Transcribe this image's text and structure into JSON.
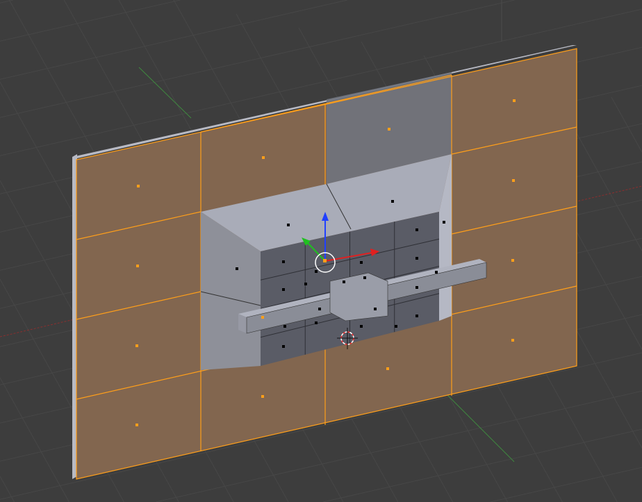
{
  "viewport": {
    "background_color": "#3d3d3d",
    "grid_color": "#474747",
    "x_axis_color": "#8a2f2f",
    "y_axis_color": "#3f8a3f",
    "selected_face_color": "#82664f",
    "selected_edge_color": "#ff9f1a",
    "mesh_light_color": "#a9acb8",
    "mesh_dark_color": "#5a5c66",
    "manipulator": {
      "x_color": "#e02020",
      "y_color": "#20c020",
      "z_color": "#2040ff"
    }
  }
}
